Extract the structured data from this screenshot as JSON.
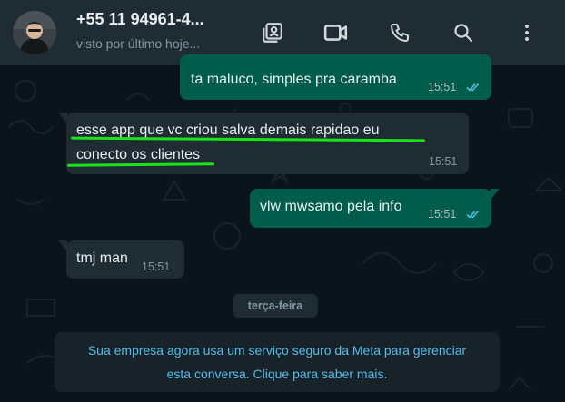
{
  "header": {
    "contact_name": "+55 11 94961-4...",
    "status": "visto por último hoje...",
    "icons": [
      "contacts-icon",
      "video-call-icon",
      "voice-call-icon",
      "search-icon",
      "menu-icon"
    ]
  },
  "messages": [
    {
      "direction": "outgoing",
      "text": "ta maluco, simples pra caramba",
      "time": "15:51",
      "status": "read"
    },
    {
      "direction": "incoming",
      "lines": [
        "esse app que vc criou salva demais rapidao eu",
        "conecto os clientes"
      ],
      "time": "15:51"
    },
    {
      "direction": "outgoing",
      "text": "vlw mwsamo pela info",
      "time": "15:51",
      "status": "read"
    },
    {
      "direction": "incoming",
      "text": "tmj man",
      "time": "15:51"
    }
  ],
  "day_separator": "terça-feira",
  "system_notice": {
    "line1": "Sua empresa agora usa um serviço seguro da Meta para gerenciar",
    "line2": "esta conversa. Clique para saber mais."
  },
  "colors": {
    "background": "#0b141a",
    "header": "#202c33",
    "incoming_bubble": "#202c33",
    "outgoing_bubble": "#005c4b",
    "read_ticks": "#53bdeb",
    "highlight_underline": "#1ee31c",
    "notice_text": "#53bdeb"
  }
}
